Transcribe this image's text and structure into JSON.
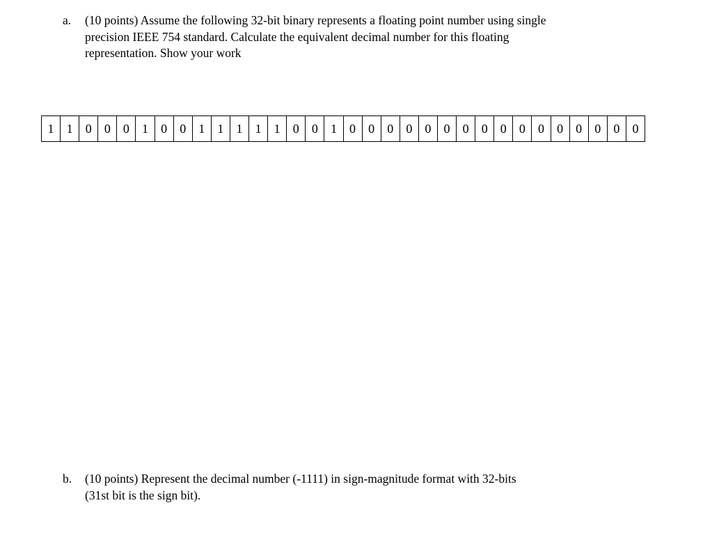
{
  "document": {
    "background_color": "#ffffff",
    "text_color": "#000000"
  },
  "questions": [
    {
      "marker": "a.",
      "lines": [
        "(10 points) Assume the following 32-bit binary represents a floating point number using single",
        "precision IEEE 754 standard. Calculate the equivalent decimal number for this floating",
        "representation. Show your work"
      ],
      "full_text": "(10 points) Assume the following 32-bit binary represents a floating point number using single precision IEEE 754 standard. Calculate the equivalent decimal number for this floating representation. Show your work",
      "points": "10 points"
    },
    {
      "marker": "b.",
      "lines": [
        "(10 points) Represent the decimal number (-1111) in sign-magnitude format with 32-bits",
        "(31st bit is the sign bit)."
      ],
      "full_text": "(10 points) Represent the decimal number (-1111) in sign-magnitude format with 32-bits (31st bit is the sign bit).",
      "points": "10 points"
    }
  ],
  "bit_table": {
    "bit_count": 32,
    "bit_string": "11000100111110010000000000000000",
    "bits": [
      "1",
      "1",
      "0",
      "0",
      "0",
      "1",
      "0",
      "0",
      "1",
      "1",
      "1",
      "1",
      "1",
      "0",
      "0",
      "1",
      "0",
      "0",
      "0",
      "0",
      "0",
      "0",
      "0",
      "0",
      "0",
      "0",
      "0",
      "0",
      "0",
      "0",
      "0",
      "0"
    ],
    "border_color": "#000000"
  }
}
